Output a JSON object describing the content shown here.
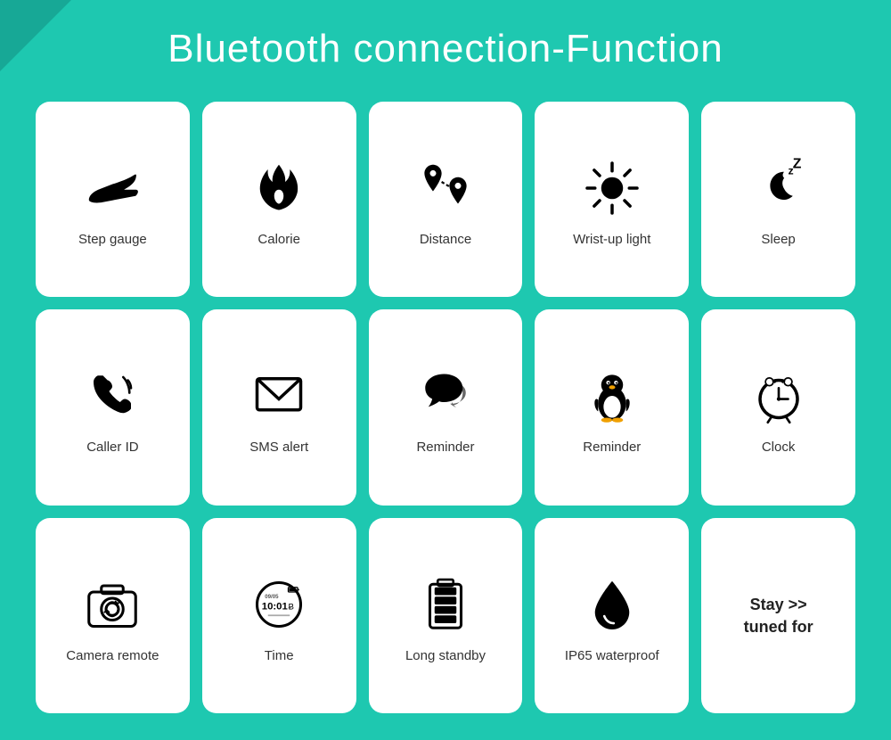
{
  "page": {
    "title": "Bluetooth connection-Function",
    "background": "#1ec8b0"
  },
  "cards": [
    {
      "id": "step-gauge",
      "label": "Step gauge",
      "icon": "shoe"
    },
    {
      "id": "calorie",
      "label": "Calorie",
      "icon": "flame"
    },
    {
      "id": "distance",
      "label": "Distance",
      "icon": "distance"
    },
    {
      "id": "wrist-up-light",
      "label": "Wrist-up light",
      "icon": "sun"
    },
    {
      "id": "sleep",
      "label": "Sleep",
      "icon": "sleep"
    },
    {
      "id": "caller-id",
      "label": "Caller ID",
      "icon": "phone"
    },
    {
      "id": "sms-alert",
      "label": "SMS alert",
      "icon": "sms"
    },
    {
      "id": "reminder-chat",
      "label": "Reminder",
      "icon": "chat"
    },
    {
      "id": "reminder-qq",
      "label": "Reminder",
      "icon": "penguin"
    },
    {
      "id": "clock",
      "label": "Clock",
      "icon": "clock"
    },
    {
      "id": "camera-remote",
      "label": "Camera remote",
      "icon": "camera"
    },
    {
      "id": "time",
      "label": "Time",
      "icon": "watchface"
    },
    {
      "id": "long-standby",
      "label": "Long standby",
      "icon": "battery"
    },
    {
      "id": "ip65-waterproof",
      "label": "IP65  waterproof",
      "icon": "water"
    },
    {
      "id": "stay-tuned",
      "label": "Stay >>\ntuned for",
      "icon": "none"
    }
  ]
}
